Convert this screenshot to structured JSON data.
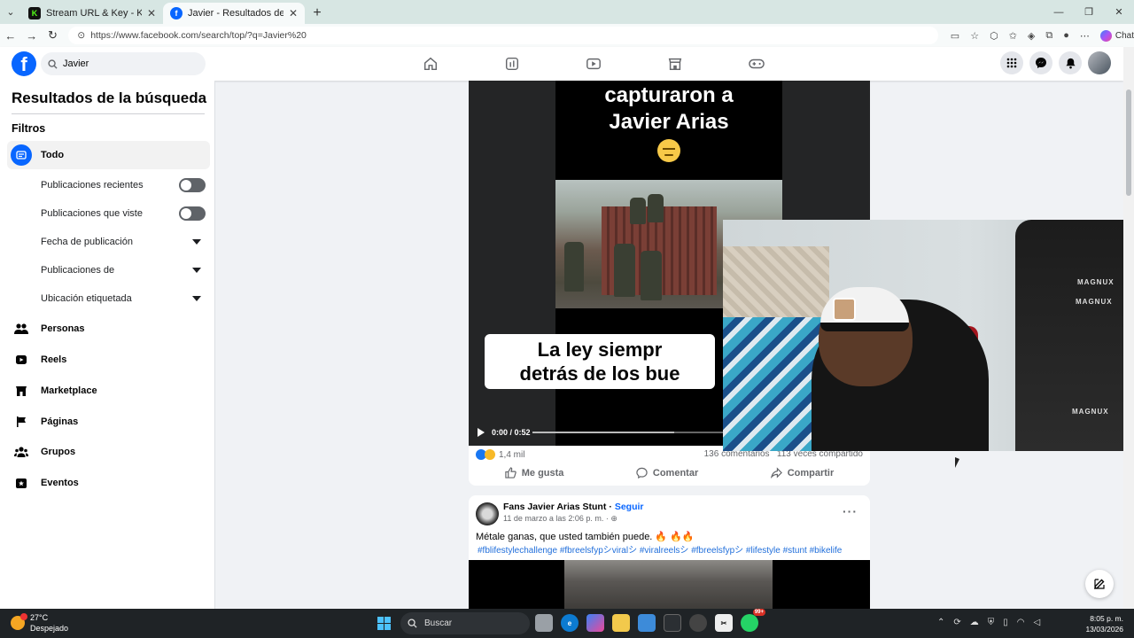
{
  "browser": {
    "tabs": [
      {
        "label": "Stream URL & Key - Kick Dashboard",
        "icon": "kick-icon",
        "color": "#53fc18",
        "active": false
      },
      {
        "label": "Javier - Resultados de búsqueda | Facebook",
        "icon": "facebook-icon",
        "color": "#0866ff",
        "active": true
      }
    ],
    "url": "https://www.facebook.com/search/top/?q=Javier%20",
    "chat_label": "Chat"
  },
  "facebook": {
    "logo": "f",
    "search_value": "Javier",
    "nav_icons": [
      "home-icon",
      "pages-icon",
      "video-icon",
      "marketplace-icon",
      "gaming-icon"
    ],
    "accent": "#0866ff"
  },
  "sidebar": {
    "title": "Resultados de la búsqueda",
    "filters_label": "Filtros",
    "todo_label": "Todo",
    "sub_filters": [
      {
        "label": "Publicaciones recientes",
        "control": "toggle"
      },
      {
        "label": "Publicaciones que viste",
        "control": "toggle"
      },
      {
        "label": "Fecha de publicación",
        "control": "dropdown"
      },
      {
        "label": "Publicaciones de",
        "control": "dropdown"
      },
      {
        "label": "Ubicación etiquetada",
        "control": "dropdown"
      }
    ],
    "categories": [
      {
        "label": "Personas",
        "icon": "people-icon"
      },
      {
        "label": "Reels",
        "icon": "reels-icon"
      },
      {
        "label": "Marketplace",
        "icon": "marketplace-icon"
      },
      {
        "label": "Páginas",
        "icon": "flag-icon"
      },
      {
        "label": "Grupos",
        "icon": "groups-icon"
      },
      {
        "label": "Eventos",
        "icon": "calendar-icon"
      }
    ]
  },
  "post1": {
    "caption_top_line1": "capturaron a",
    "caption_top_line2": "Javier Arias",
    "caption_bottom_line1": "La ley siempr",
    "caption_bottom_line2": "detrás de los bue",
    "video_time": "0:00 / 0:52",
    "reactions": "1,4 mil",
    "comments": "136 comentarios",
    "shares": "113 veces compartido",
    "like_label": "Me gusta",
    "comment_label": "Comentar",
    "share_label": "Compartir"
  },
  "post2": {
    "author": "Fans Javier Arias Stunt",
    "follow": "Seguir",
    "time": "11 de marzo a las 2:06 p. m. ·",
    "text": "Métale ganas, que usted también puede. 🔥 🔥🔥",
    "hashtags": "#fblifestylechallenge #fbreelsfypシviralシ #viralreelsシ #fbreelsfypシ #lifestyle #stunt #bikelife"
  },
  "webcam": {
    "chair_brand": "MAGNUX"
  },
  "taskbar": {
    "temp": "27°C",
    "weather": "Despejado",
    "search_label": "Buscar",
    "badge": "99+",
    "time": "8:05 p. m.",
    "date": "13/03/2026"
  }
}
